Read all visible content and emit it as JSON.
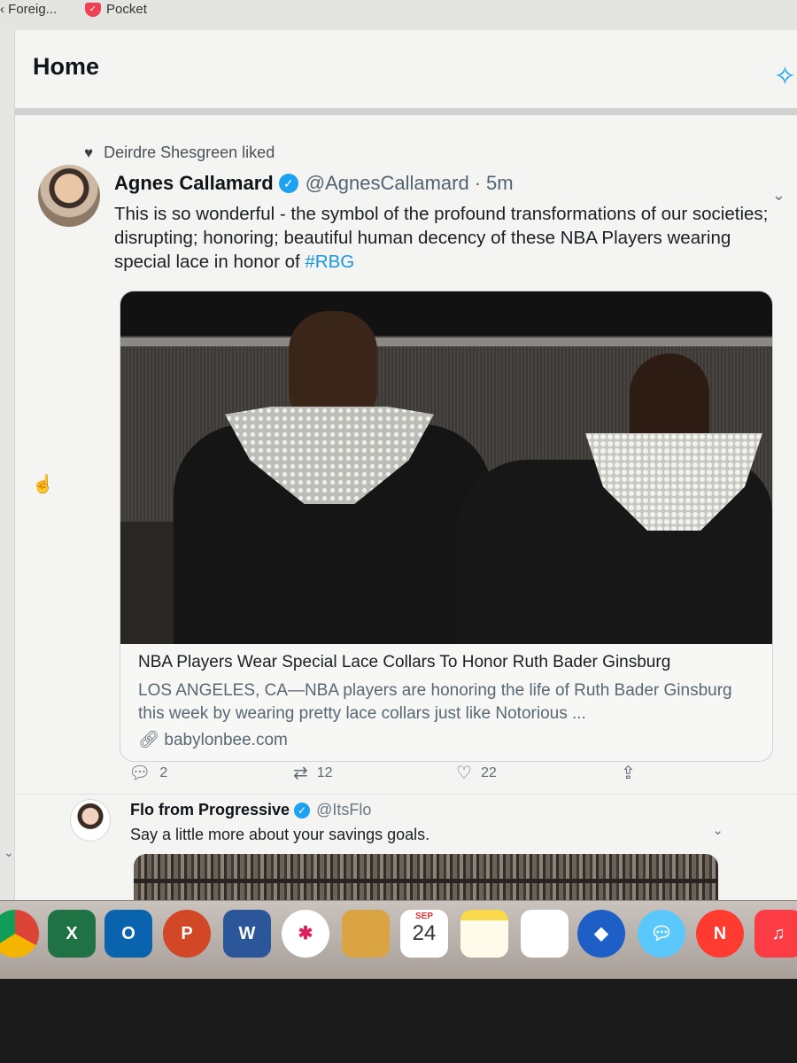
{
  "browser": {
    "bookmarks": [
      {
        "label": "‹ Foreig..."
      },
      {
        "label": "Pocket"
      }
    ]
  },
  "header": {
    "title": "Home",
    "sparkle_icon": "sparkle-icon"
  },
  "tweet1": {
    "social_context": "Deirdre Shesgreen liked",
    "author_name": "Agnes Callamard",
    "handle": "@AgnesCallamard",
    "separator": "·",
    "time": "5m",
    "text": "This is so wonderful - the symbol of the profound transformations of our societies; disrupting; honoring; beautiful human decency of these NBA Players wearing special lace in honor of",
    "hashtag": "#RBG",
    "card": {
      "title": "NBA Players Wear Special Lace Collars To Honor Ruth Bader Ginsburg",
      "description": "LOS ANGELES, CA—NBA players are honoring the life of Ruth Bader Ginsburg this week by wearing pretty lace collars just like Notorious ...",
      "domain": "babylonbee.com"
    },
    "actions": {
      "replies": "2",
      "retweets": "12",
      "likes": "22"
    }
  },
  "tweet2": {
    "author_name": "Flo from Progressive",
    "handle": "@ItsFlo",
    "text": "Say a little more about your savings goals."
  },
  "dock": {
    "calendar_month": "SEP",
    "calendar_day": "24",
    "letters": {
      "excel": "X",
      "outlook": "O",
      "powerpoint": "P",
      "word": "W"
    }
  },
  "colors": {
    "accent": "#1da1f2",
    "hashtag": "#1b95e0",
    "muted_text": "#536471",
    "page_bg": "#f4f4f2"
  }
}
